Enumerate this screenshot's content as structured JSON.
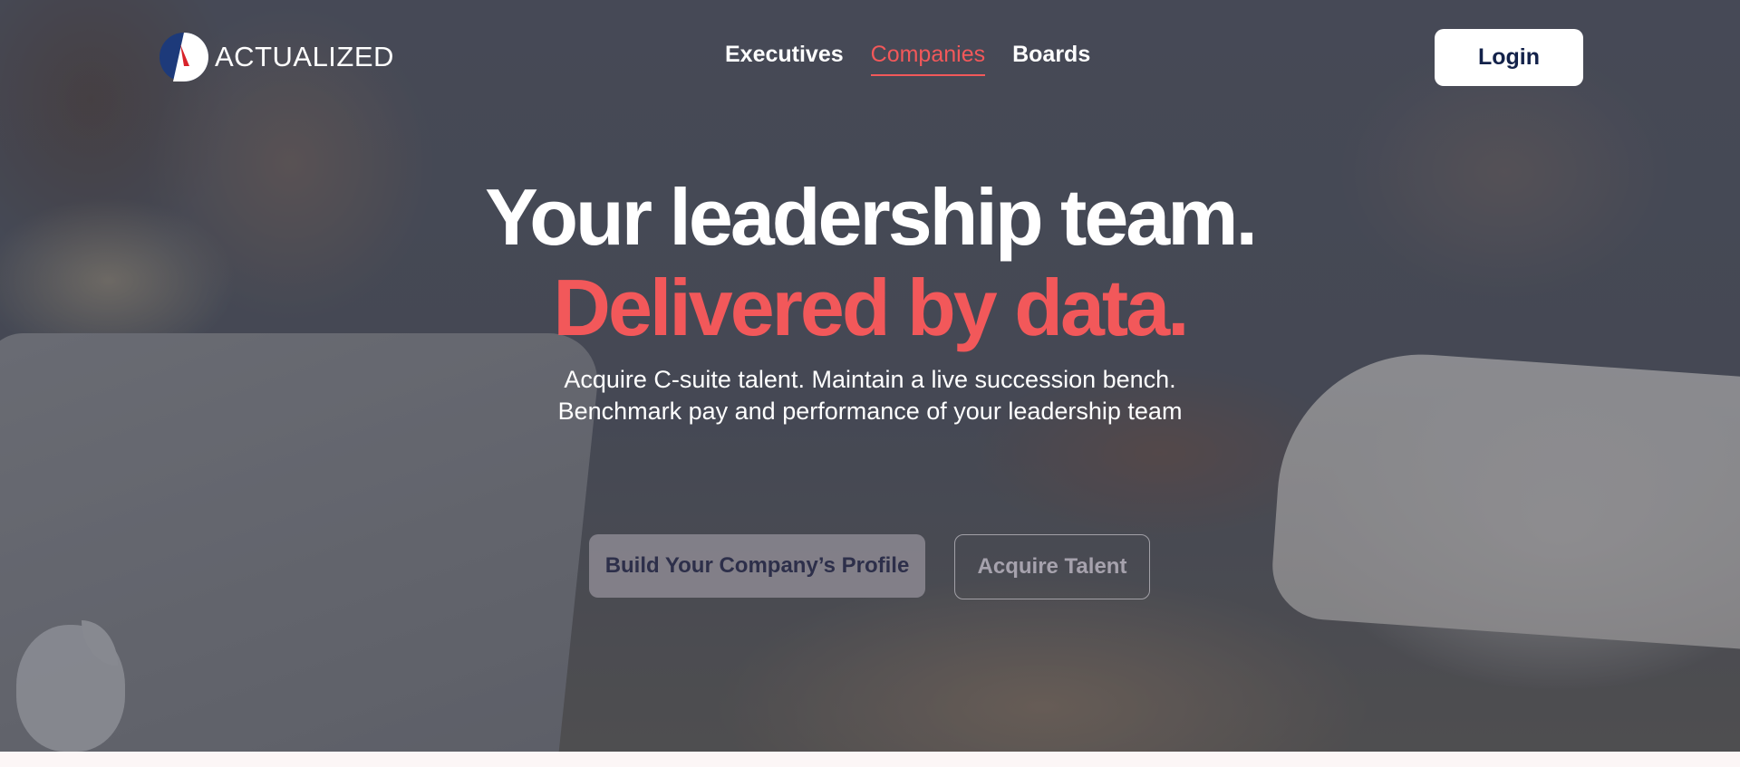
{
  "brand": {
    "name": "ACTUALIZED",
    "colors": {
      "accent": "#f2585a",
      "navy": "#13224a",
      "logo_red": "#d8232a"
    }
  },
  "nav": {
    "items": [
      {
        "label": "Executives",
        "active": false
      },
      {
        "label": "Companies",
        "active": true
      },
      {
        "label": "Boards",
        "active": false
      }
    ],
    "login_label": "Login"
  },
  "hero": {
    "headline_line1": "Your leadership team.",
    "headline_line2": "Delivered by data.",
    "subtitle_line1": "Acquire C-suite talent. Maintain a live succession bench.",
    "subtitle_line2": "Benchmark pay and performance of your leadership team",
    "cta_primary": "Build Your Company’s Profile",
    "cta_secondary": "Acquire Talent"
  },
  "icons": {
    "logo": "actualized-logo-icon",
    "background_logo": "apple-icon"
  }
}
